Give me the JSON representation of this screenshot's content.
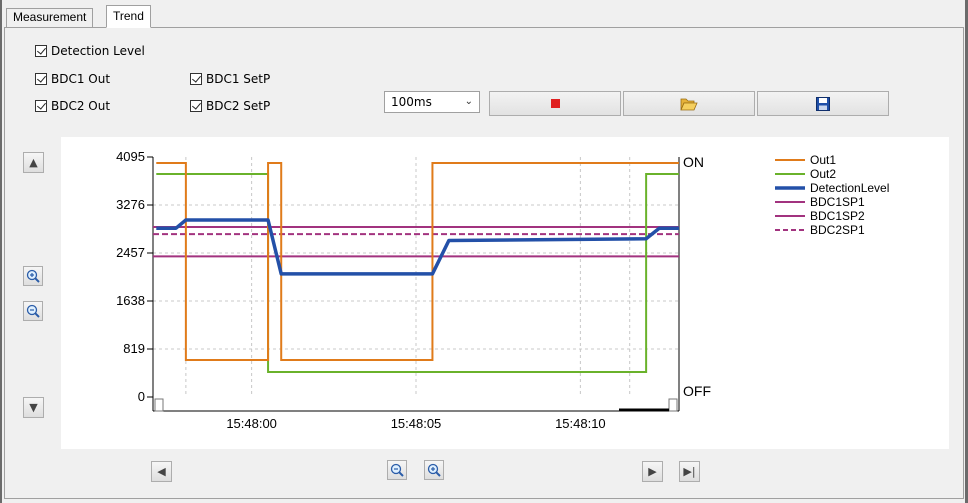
{
  "tabs": [
    {
      "label": "Measurement",
      "active": false
    },
    {
      "label": "Trend",
      "active": true
    }
  ],
  "checkboxes": {
    "detection_level": {
      "label": "Detection Level",
      "checked": true
    },
    "bdc1_out": {
      "label": "BDC1 Out",
      "checked": true
    },
    "bdc2_out": {
      "label": "BDC2 Out",
      "checked": true
    },
    "bdc1_setp": {
      "label": "BDC1 SetP",
      "checked": true
    },
    "bdc2_setp": {
      "label": "BDC2 SetP",
      "checked": true
    }
  },
  "toolbar": {
    "interval": "100ms",
    "stop_icon": "stop-icon",
    "open_icon": "open-folder-icon",
    "save_icon": "save-disk-icon"
  },
  "chart_data": {
    "type": "line",
    "y_ticks": [
      "4095",
      "3276",
      "2457",
      "1638",
      "819",
      "0"
    ],
    "ylim": [
      0,
      4095
    ],
    "x_ticks": [
      "15:48:00",
      "15:48:05",
      "15:48:10"
    ],
    "right_labels": {
      "top": "ON",
      "bottom": "OFF"
    },
    "grid": true,
    "legend_position": "right",
    "series": [
      {
        "name": "Out1",
        "color": "#e07b1a",
        "style": "solid"
      },
      {
        "name": "Out2",
        "color": "#6ab22b",
        "style": "solid"
      },
      {
        "name": "DetectionLevel",
        "color": "#2350a8",
        "style": "solid-thick"
      },
      {
        "name": "BDC1SP1",
        "color": "#a2337f",
        "style": "solid"
      },
      {
        "name": "BDC1SP2",
        "color": "#a2337f",
        "style": "solid"
      },
      {
        "name": "BDC2SP1",
        "color": "#a2337f",
        "style": "dashed"
      }
    ],
    "levels": {
      "BDC1SP1": 2900,
      "BDC1SP2": 2400,
      "BDC2SP1": 2780
    },
    "detection_level": [
      {
        "x": "15:47:57.1",
        "y": 2880
      },
      {
        "x": "15:47:57.7",
        "y": 2880
      },
      {
        "x": "15:47:58.0",
        "y": 3020
      },
      {
        "x": "15:48:00.5",
        "y": 3020
      },
      {
        "x": "15:48:00.9",
        "y": 2100
      },
      {
        "x": "15:48:05.5",
        "y": 2100
      },
      {
        "x": "15:48:06.0",
        "y": 2670
      },
      {
        "x": "15:48:12.0",
        "y": 2700
      },
      {
        "x": "15:48:12.4",
        "y": 2880
      },
      {
        "x": "15:48:13.0",
        "y": 2880
      }
    ],
    "out1_on_off": [
      {
        "x": "15:47:57.1",
        "state": "ON"
      },
      {
        "x": "15:47:58.0",
        "state": "OFF"
      },
      {
        "x": "15:48:00.5",
        "state": "ON"
      },
      {
        "x": "15:48:00.9",
        "state": "OFF"
      },
      {
        "x": "15:48:05.5",
        "state": "ON"
      },
      {
        "x": "15:48:13.0",
        "state": "ON"
      }
    ],
    "out2_on_off": [
      {
        "x": "15:47:57.1",
        "state": "ON"
      },
      {
        "x": "15:48:00.5",
        "state": "OFF"
      },
      {
        "x": "15:48:12.0",
        "state": "ON"
      },
      {
        "x": "15:48:13.0",
        "state": "ON"
      }
    ]
  },
  "side_controls": {
    "scroll_up_icon": "triangle-up-icon",
    "zoom_in_icon": "zoom-in-icon",
    "zoom_out_icon": "zoom-out-icon",
    "scroll_down_icon": "triangle-down-icon"
  },
  "bottom_controls": {
    "scroll_left_icon": "triangle-left-icon",
    "zoom_out_icon": "zoom-out-icon",
    "zoom_in_icon": "zoom-in-icon",
    "scroll_right_icon": "triangle-right-icon",
    "scroll_end_icon": "skip-to-end-icon"
  }
}
